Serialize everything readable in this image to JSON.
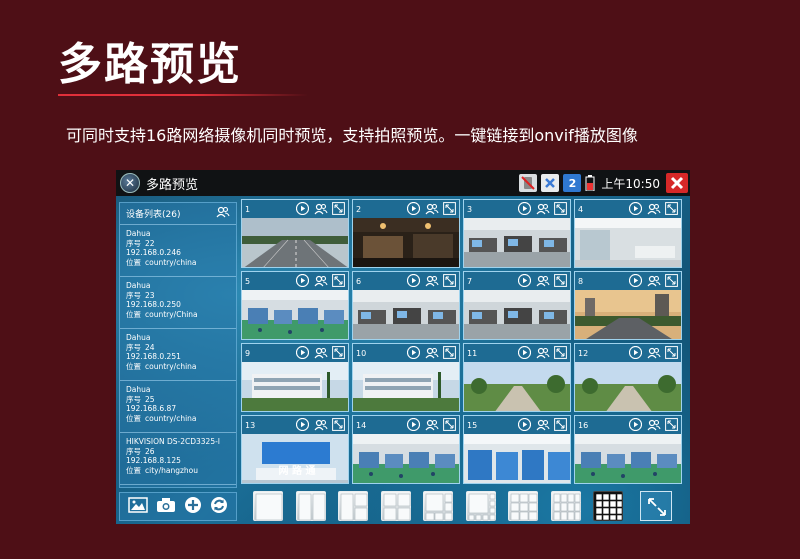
{
  "page": {
    "title": "多路预览",
    "subtitle": "可同时支持16路网络摄像机同时预览，支持拍照预览。一键链接到onvif播放图像",
    "accent_color": "#e0303a",
    "background_color": "#4e0f16"
  },
  "titlebar": {
    "app_title": "多路预览",
    "time": "上午10:50",
    "indicator_2": "2",
    "icons": [
      "app-tools-icon",
      "sd-card-icon",
      "close-x-icon",
      "badge-2-icon",
      "battery-icon",
      "close-button-icon"
    ]
  },
  "sidebar": {
    "header": "设备列表(26)",
    "header_icon": "people-icon",
    "items": [
      {
        "brand": "Dahua",
        "serial_label": "序号",
        "serial": "22",
        "ip": "192.168.0.246",
        "loc_label": "位置",
        "location": "country/china"
      },
      {
        "brand": "Dahua",
        "serial_label": "序号",
        "serial": "23",
        "ip": "192.168.0.250",
        "loc_label": "位置",
        "location": "country/China"
      },
      {
        "brand": "Dahua",
        "serial_label": "序号",
        "serial": "24",
        "ip": "192.168.0.251",
        "loc_label": "位置",
        "location": "country/china"
      },
      {
        "brand": "Dahua",
        "serial_label": "序号",
        "serial": "25",
        "ip": "192.168.6.87",
        "loc_label": "位置",
        "location": "country/china"
      },
      {
        "brand": "HIKVISION DS-2CD3325-I",
        "serial_label": "序号",
        "serial": "26",
        "ip": "192.168.8.125",
        "loc_label": "位置",
        "location": "city/hangzhou"
      }
    ]
  },
  "channels": [
    {
      "num": "1",
      "scene": "highway"
    },
    {
      "num": "2",
      "scene": "lobby"
    },
    {
      "num": "3",
      "scene": "office"
    },
    {
      "num": "4",
      "scene": "hall"
    },
    {
      "num": "5",
      "scene": "factory"
    },
    {
      "num": "6",
      "scene": "office"
    },
    {
      "num": "7",
      "scene": "office"
    },
    {
      "num": "8",
      "scene": "street"
    },
    {
      "num": "9",
      "scene": "building"
    },
    {
      "num": "10",
      "scene": "building"
    },
    {
      "num": "11",
      "scene": "park"
    },
    {
      "num": "12",
      "scene": "park"
    },
    {
      "num": "13",
      "scene": "reception"
    },
    {
      "num": "14",
      "scene": "factory"
    },
    {
      "num": "15",
      "scene": "warehouse"
    },
    {
      "num": "16",
      "scene": "factory"
    }
  ],
  "cell_controls": [
    "play-icon",
    "people-icon",
    "fullscreen-icon"
  ],
  "reception_sign": "网 路 通",
  "bottom_tools": [
    "image-icon",
    "camera-icon",
    "add-icon",
    "refresh-icon"
  ],
  "layouts": [
    "1",
    "2",
    "3",
    "4",
    "6",
    "8",
    "9",
    "12",
    "16"
  ],
  "active_layout": "16"
}
